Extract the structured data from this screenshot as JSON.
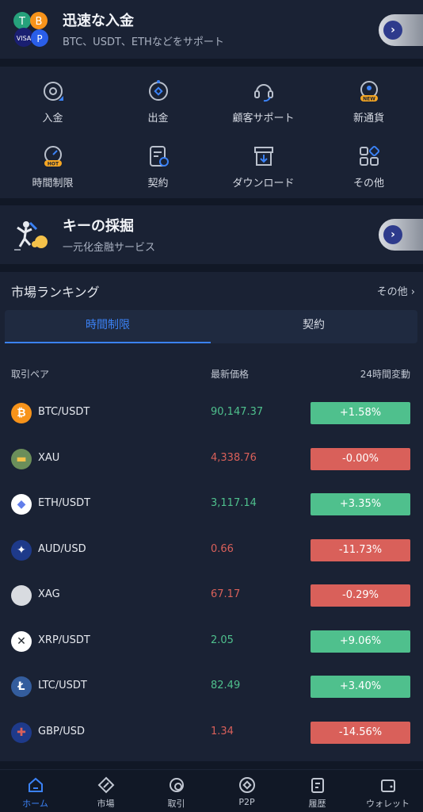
{
  "banner1": {
    "title": "迅速な入金",
    "subtitle": "BTC、USDT、ETHなどをサポート"
  },
  "menu": [
    {
      "label": "入金",
      "icon": "deposit-icon"
    },
    {
      "label": "出金",
      "icon": "withdraw-icon"
    },
    {
      "label": "顧客サポート",
      "icon": "support-headset-icon"
    },
    {
      "label": "新通貨",
      "icon": "new-coin-icon",
      "badge": "NEW"
    },
    {
      "label": "時間制限",
      "icon": "timer-icon",
      "badge": "HOT"
    },
    {
      "label": "契約",
      "icon": "contract-icon"
    },
    {
      "label": "ダウンロード",
      "icon": "download-icon"
    },
    {
      "label": "その他",
      "icon": "more-grid-icon"
    }
  ],
  "banner2": {
    "title": "キーの採掘",
    "subtitle": "一元化金融サービス"
  },
  "market": {
    "title": "市場ランキング",
    "more": "その他",
    "tabs": [
      "時間制限",
      "契約"
    ],
    "headers": {
      "pair": "取引ペア",
      "price": "最新価格",
      "change": "24時間変動"
    },
    "rows": [
      {
        "pair": "BTC/USDT",
        "price": "90,147.37",
        "change": "+1.58%",
        "up": true,
        "icon": "bitcoin-icon"
      },
      {
        "pair": "XAU",
        "price": "4,338.76",
        "change": "-0.00%",
        "up": false,
        "icon": "gold-icon"
      },
      {
        "pair": "ETH/USDT",
        "price": "3,117.14",
        "change": "+3.35%",
        "up": true,
        "icon": "ethereum-icon"
      },
      {
        "pair": "AUD/USD",
        "price": "0.66",
        "change": "-11.73%",
        "up": false,
        "icon": "australia-flag-icon"
      },
      {
        "pair": "XAG",
        "price": "67.17",
        "change": "-0.29%",
        "up": false,
        "icon": "silver-icon"
      },
      {
        "pair": "XRP/USDT",
        "price": "2.05",
        "change": "+9.06%",
        "up": true,
        "icon": "xrp-icon"
      },
      {
        "pair": "LTC/USDT",
        "price": "82.49",
        "change": "+3.40%",
        "up": true,
        "icon": "litecoin-icon"
      },
      {
        "pair": "GBP/USD",
        "price": "1.34",
        "change": "-14.56%",
        "up": false,
        "icon": "uk-flag-icon"
      }
    ]
  },
  "nav": [
    {
      "label": "ホーム",
      "icon": "home-icon",
      "active": true
    },
    {
      "label": "市場",
      "icon": "market-compass-icon"
    },
    {
      "label": "取引",
      "icon": "trade-icon"
    },
    {
      "label": "P2P",
      "icon": "p2p-icon"
    },
    {
      "label": "履歴",
      "icon": "history-icon"
    },
    {
      "label": "ウォレット",
      "icon": "wallet-icon"
    }
  ],
  "colors": {
    "up": "#4fc08d",
    "down": "#d9605a",
    "accent": "#3b82f6",
    "bg": "#111826",
    "card": "#1a2234"
  }
}
